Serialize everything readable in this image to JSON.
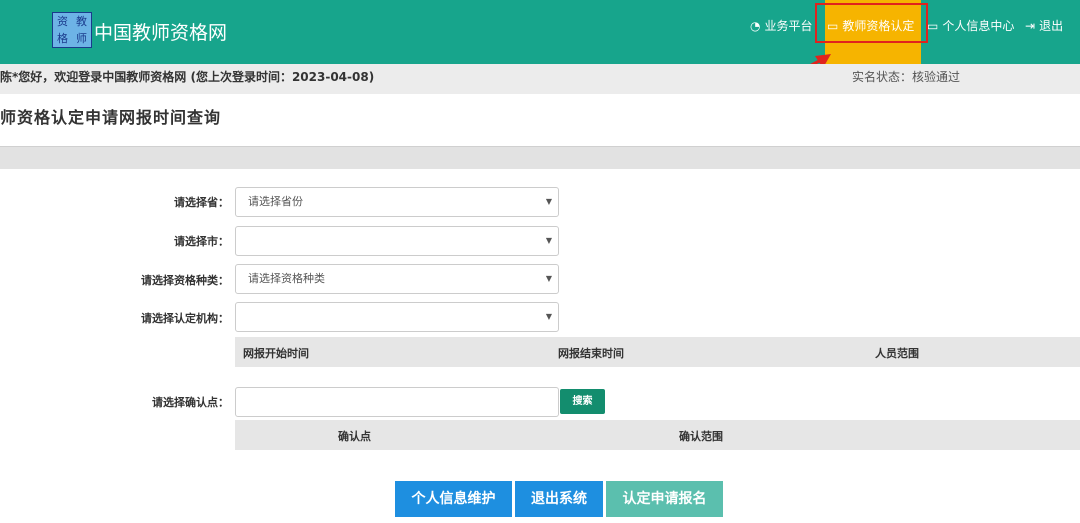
{
  "header": {
    "logo_chars": [
      "资",
      "教",
      "格",
      "师"
    ],
    "site_name": "中国教师资格网",
    "nav": [
      {
        "label": "业务平台",
        "icon": "gauge-icon"
      },
      {
        "label": "教师资格认定",
        "icon": "monitor-icon",
        "active": true
      },
      {
        "label": "个人信息中心",
        "icon": "monitor-icon"
      },
      {
        "label": "退出",
        "icon": "logout-icon"
      }
    ]
  },
  "welcome": {
    "message": "陈*您好，欢迎登录中国教师资格网 (您上次登录时间：2023-04-08)",
    "status": "实名状态：核验通过"
  },
  "page_title": "师资格认定申请网报时间查询",
  "form": {
    "province_label": "请选择省：",
    "province_value": "请选择省份",
    "city_label": "请选择市：",
    "city_value": "",
    "type_label": "请选择资格种类：",
    "type_value": "请选择资格种类",
    "agency_label": "请选择认定机构：",
    "agency_value": "",
    "table1_headers": [
      "网报开始时间",
      "网报结束时间",
      "人员范围"
    ],
    "confirm_label": "请选择确认点：",
    "confirm_value": "",
    "search_label": "搜索",
    "table2_headers": [
      "确认点",
      "确认范围"
    ]
  },
  "buttons": {
    "personal_info": "个人信息维护",
    "exit_system": "退出系统",
    "apply": "认定申请报名"
  },
  "colors": {
    "header_bg": "#17a58c",
    "active_nav": "#f6b400",
    "primary_btn": "#1e8fe0",
    "disabled_btn": "#5bbfae",
    "annotation": "#e0231e"
  }
}
